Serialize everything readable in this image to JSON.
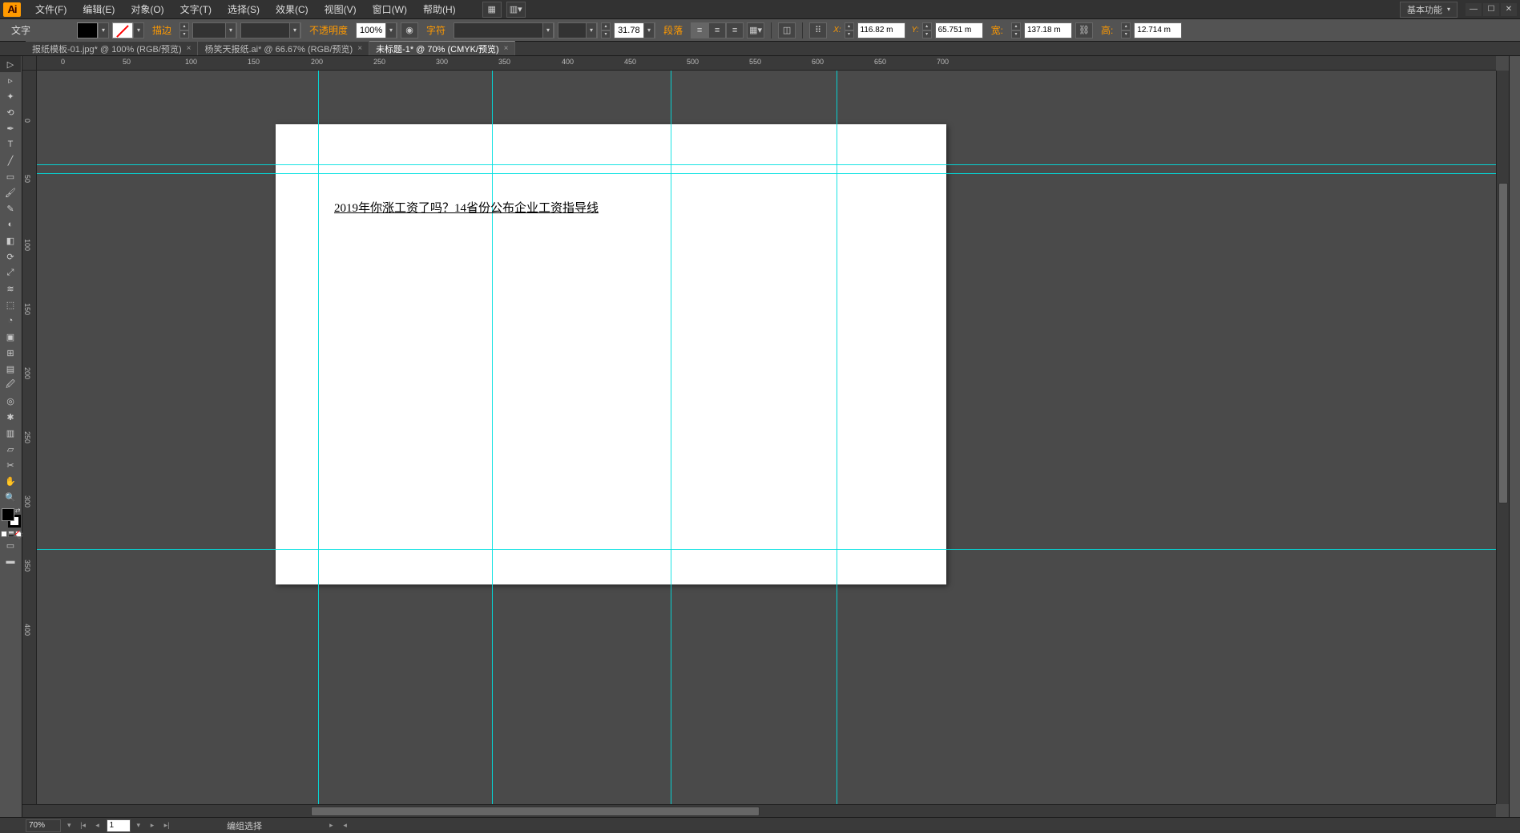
{
  "app_logo": "Ai",
  "menu": [
    "文件(F)",
    "编辑(E)",
    "对象(O)",
    "文字(T)",
    "选择(S)",
    "效果(C)",
    "视图(V)",
    "窗口(W)",
    "帮助(H)"
  ],
  "workspace": "基本功能",
  "ctrl": {
    "mode": "文字",
    "stroke_label": "描边",
    "opacity_label": "不透明度",
    "opacity_value": "100%",
    "char_label": "字符",
    "font_size": "31.78",
    "para_label": "段落",
    "x": "116.82 m",
    "y": "65.751 m",
    "w_label": "宽:",
    "w": "137.18 m",
    "h_label": "高:",
    "h": "12.714 m"
  },
  "tabs": [
    {
      "label": "报纸模板-01.jpg* @ 100% (RGB/预览)",
      "active": false
    },
    {
      "label": "杨笑天报纸.ai* @ 66.67% (RGB/预览)",
      "active": false
    },
    {
      "label": "未标题-1* @ 70% (CMYK/预览)",
      "active": true
    }
  ],
  "ruler_h": [
    "50",
    "100",
    "150",
    "200",
    "250",
    "300",
    "350",
    "400",
    "450",
    "500",
    "550",
    "600",
    "650",
    "700"
  ],
  "ruler_h_zero": "0",
  "ruler_v": [
    "0",
    "50",
    "100",
    "150",
    "200",
    "250",
    "300",
    "350",
    "400"
  ],
  "canvas_text": "2019年你涨工资了吗？14省份公布企业工资指导线",
  "status": {
    "zoom": "70%",
    "artboard": "1",
    "tool": "编组选择"
  }
}
